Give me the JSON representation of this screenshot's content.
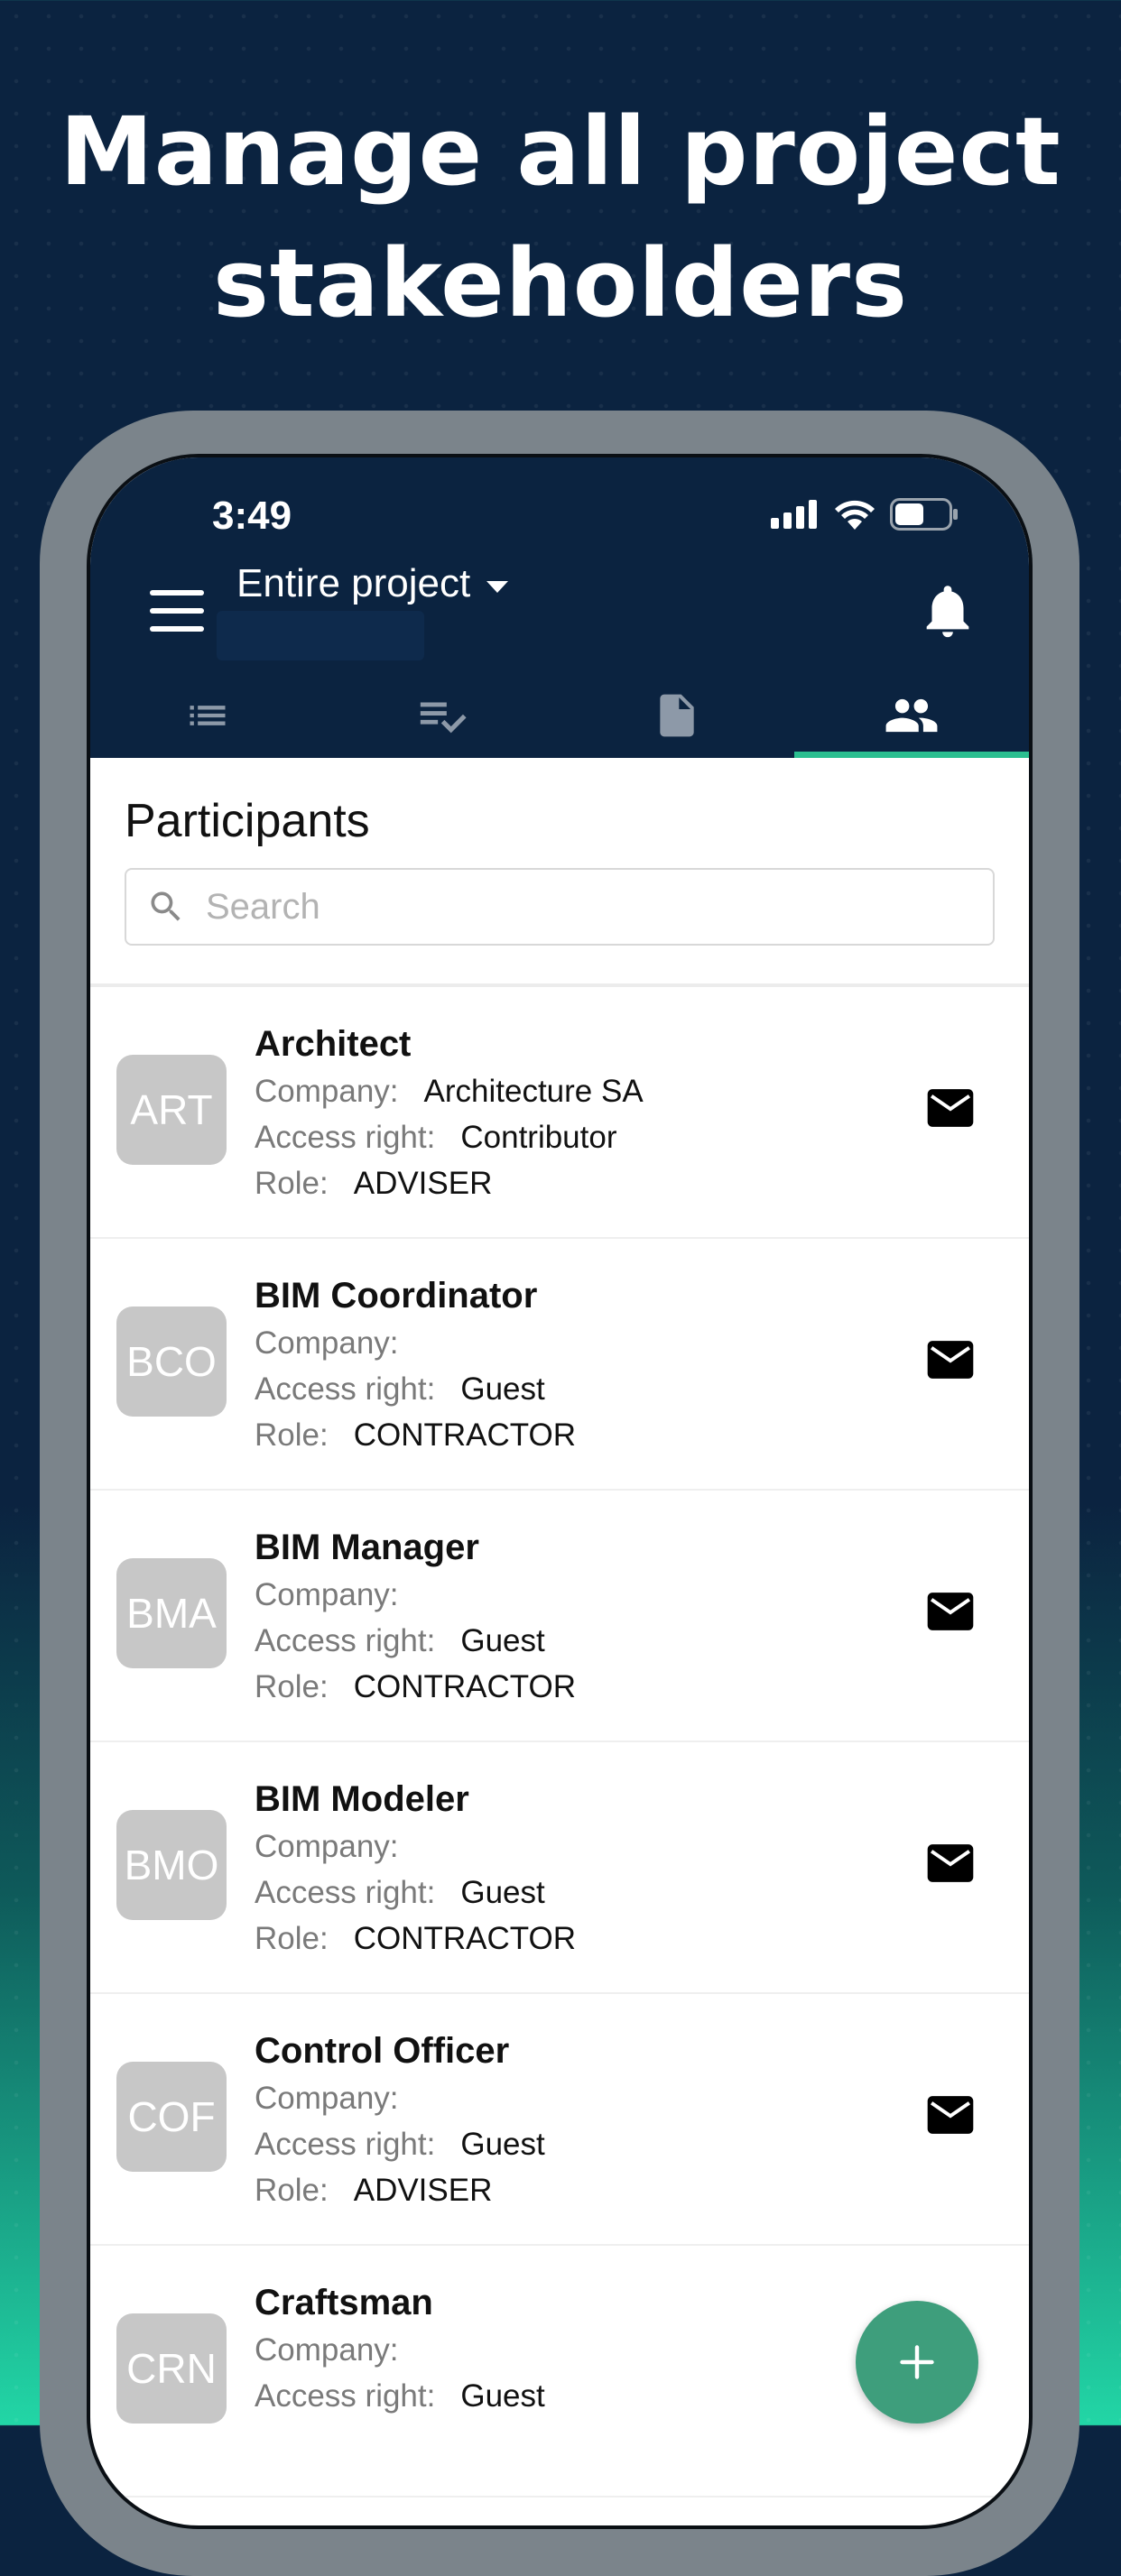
{
  "headline": {
    "line1": "Manage all project",
    "line2": "stakeholders"
  },
  "status_bar": {
    "time": "3:49",
    "battery_level": 0.55
  },
  "header": {
    "project_label": "Entire project",
    "menu_icon": "hamburger-menu-icon",
    "notifications_icon": "bell-icon"
  },
  "tabs": [
    {
      "icon": "list-icon",
      "active": false
    },
    {
      "icon": "checklist-icon",
      "active": false
    },
    {
      "icon": "document-icon",
      "active": false
    },
    {
      "icon": "people-icon",
      "active": true
    }
  ],
  "participants": {
    "title": "Participants",
    "search_placeholder": "Search",
    "labels": {
      "company": "Company:",
      "access_right": "Access right:",
      "role": "Role:"
    },
    "items": [
      {
        "initials": "ART",
        "name": "Architect",
        "company": "Architecture SA",
        "access_right": "Contributor",
        "role": "ADVISER"
      },
      {
        "initials": "BCO",
        "name": "BIM Coordinator",
        "company": "",
        "access_right": "Guest",
        "role": "CONTRACTOR"
      },
      {
        "initials": "BMA",
        "name": "BIM Manager",
        "company": "",
        "access_right": "Guest",
        "role": "CONTRACTOR"
      },
      {
        "initials": "BMO",
        "name": "BIM Modeler",
        "company": "",
        "access_right": "Guest",
        "role": "CONTRACTOR"
      },
      {
        "initials": "COF",
        "name": "Control Officer",
        "company": "",
        "access_right": "Guest",
        "role": "ADVISER"
      },
      {
        "initials": "CRN",
        "name": "Craftsman",
        "company": "",
        "access_right": "Guest",
        "role": ""
      }
    ]
  },
  "colors": {
    "header_bg": "#0b2340",
    "accent": "#2bbf90",
    "fab": "#3e9e7c",
    "avatar_bg": "#c7c7c7"
  },
  "fab_icon": "plus-icon"
}
